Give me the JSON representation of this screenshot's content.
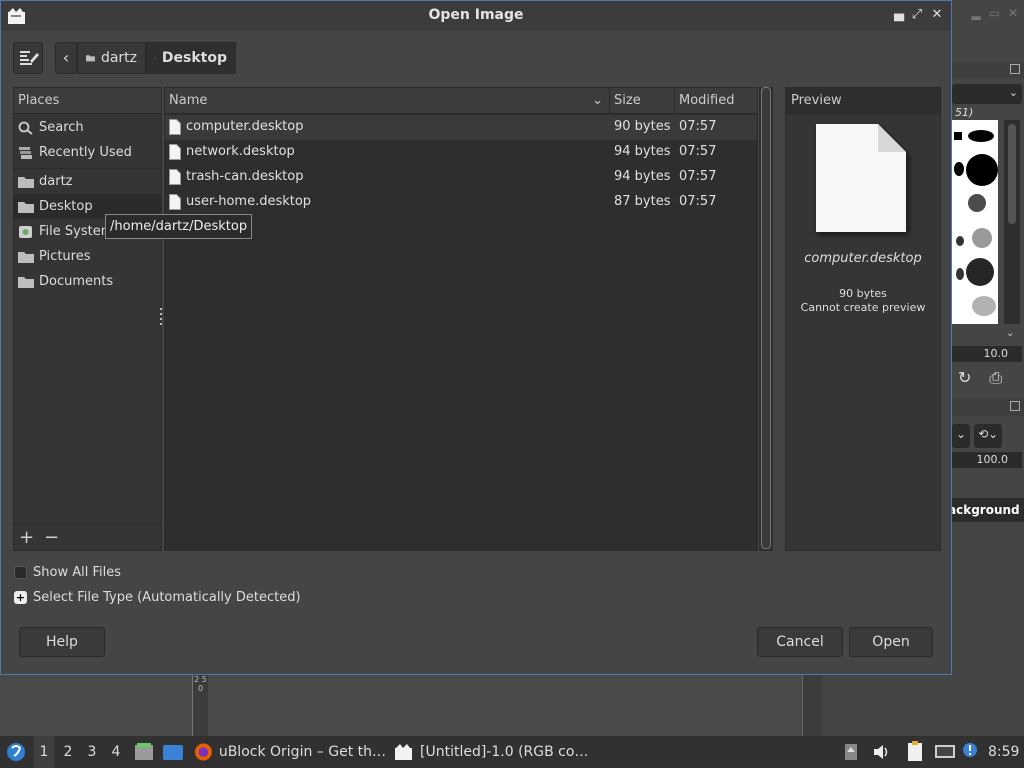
{
  "dialog": {
    "title": "Open Image",
    "window_buttons": [
      "▄",
      "⤢",
      "✕"
    ]
  },
  "breadcrumbs": [
    {
      "label": "dartz",
      "active": false
    },
    {
      "label": "Desktop",
      "active": true
    }
  ],
  "places": {
    "header": "Places",
    "items": [
      {
        "label": "Search",
        "icon": "search-icon"
      },
      {
        "label": "Recently Used",
        "icon": "recent-icon"
      },
      {
        "label": "dartz",
        "icon": "folder-icon"
      },
      {
        "label": "Desktop",
        "icon": "folder-icon",
        "selected": true
      },
      {
        "label": "File System",
        "icon": "drive-icon"
      },
      {
        "label": "Pictures",
        "icon": "folder-icon"
      },
      {
        "label": "Documents",
        "icon": "folder-icon"
      }
    ],
    "add_label": "+",
    "remove_label": "−"
  },
  "tooltip": "/home/dartz/Desktop",
  "file_list": {
    "columns": {
      "name": "Name",
      "size": "Size",
      "modified": "Modified"
    },
    "rows": [
      {
        "name": "computer.desktop",
        "size": "90 bytes",
        "modified": "07:57",
        "selected": true
      },
      {
        "name": "network.desktop",
        "size": "94 bytes",
        "modified": "07:57"
      },
      {
        "name": "trash-can.desktop",
        "size": "94 bytes",
        "modified": "07:57"
      },
      {
        "name": "user-home.desktop",
        "size": "87 bytes",
        "modified": "07:57"
      }
    ]
  },
  "preview": {
    "header": "Preview",
    "filename": "computer.desktop",
    "size": "90 bytes",
    "message": "Cannot create preview"
  },
  "options": {
    "show_all_files": "Show All Files",
    "select_file_type": "Select File Type (Automatically Detected)"
  },
  "buttons": {
    "help": "Help",
    "cancel": "Cancel",
    "open": "Open"
  },
  "gimp_bg": {
    "brush_name": "51)",
    "size_value": "10.0",
    "opacity_value": "100.0",
    "layer_name": "ackground",
    "ruler_text": "2 5 0"
  },
  "taskbar": {
    "workspaces": [
      "1",
      "2",
      "3",
      "4"
    ],
    "active_workspace": "1",
    "tasks": [
      {
        "label": "uBlock Origin – Get th…",
        "icon": "firefox-icon"
      },
      {
        "label": "[Untitled]-1.0 (RGB co…",
        "icon": "gimp-icon"
      }
    ],
    "clock": "8:59"
  }
}
